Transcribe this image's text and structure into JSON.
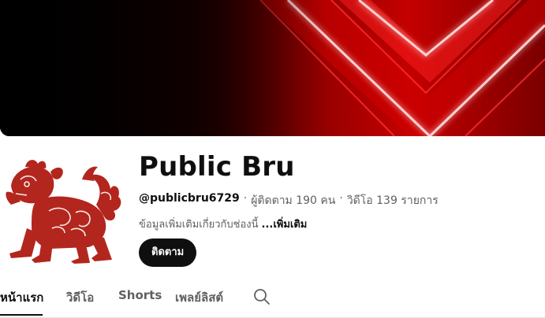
{
  "channel": {
    "name": "Public Bru",
    "handle": "@publicbru6729",
    "separator": "·",
    "subscribers": "ผู้ติดตาม 190 คน",
    "videos": "วิดีโอ 139 รายการ",
    "about": "ข้อมูลเพิ่มเติมเกี่ยวกับช่องนี้",
    "more_label": "...เพิ่มเติม",
    "subscribe_label": "ติดตาม"
  },
  "tabs": [
    {
      "label": "หน้าแรก",
      "active": true
    },
    {
      "label": "วิดีโอ",
      "active": false
    },
    {
      "label": "Shorts",
      "active": false
    },
    {
      "label": "เพลย์ลิสต์",
      "active": false
    }
  ],
  "icons": {
    "search": "search-icon",
    "avatar": "singha-lion-logo"
  },
  "colors": {
    "banner_red": "#ff1a1a",
    "avatar_red": "#b3261e",
    "subscribe_bg": "#0f0f0f"
  }
}
